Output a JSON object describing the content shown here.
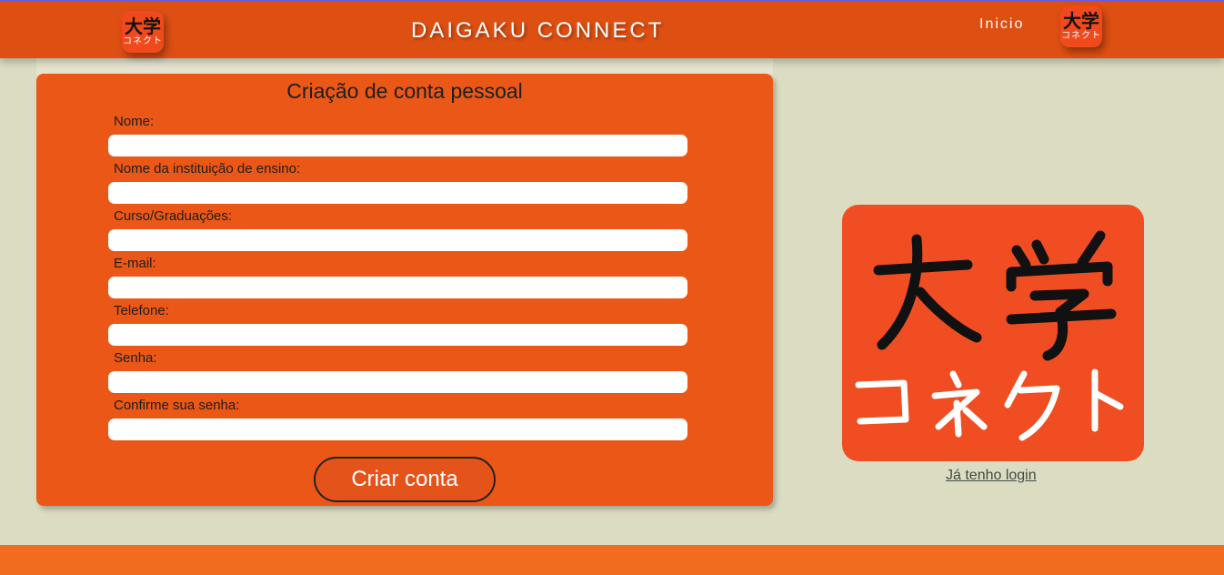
{
  "header": {
    "title": "DAIGAKU CONNECT",
    "nav_inicio": "Inicio",
    "logo_kanji": "大学",
    "logo_kana": "コネクト"
  },
  "form": {
    "title": "Criação de conta pessoal",
    "fields": [
      {
        "label": "Nome:",
        "value": ""
      },
      {
        "label": "Nome da instituição de ensino:",
        "value": ""
      },
      {
        "label": "Curso/Graduações:",
        "value": ""
      },
      {
        "label": "E-mail:",
        "value": ""
      },
      {
        "label": "Telefone:",
        "value": ""
      },
      {
        "label": "Senha:",
        "value": ""
      },
      {
        "label": "Confirme sua senha:",
        "value": ""
      }
    ],
    "submit_label": "Criar conta"
  },
  "side": {
    "login_link": "Já tenho login"
  },
  "colors": {
    "header_bg": "#de4f12",
    "card_bg": "#ea5716",
    "page_bg": "#dcdcc2",
    "logo_bg": "#f04e22",
    "footer_bg": "#f26c1f"
  }
}
